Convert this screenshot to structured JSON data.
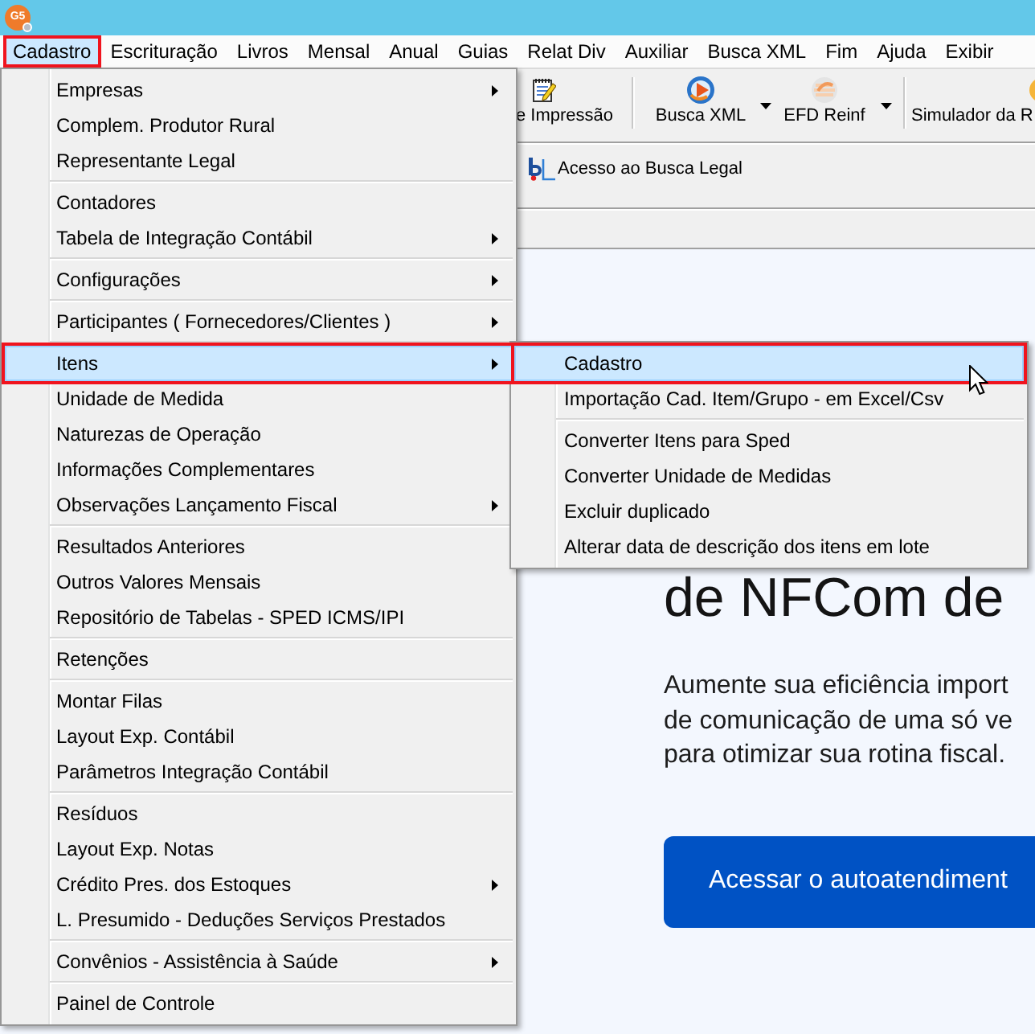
{
  "title_bar": {
    "logo_text": "G5"
  },
  "menu_bar": [
    {
      "label": "Cadastro",
      "selected": true,
      "outlined": true
    },
    {
      "label": "Escrituração",
      "selected": false,
      "outlined": false
    },
    {
      "label": "Livros",
      "selected": false,
      "outlined": false
    },
    {
      "label": "Mensal",
      "selected": false,
      "outlined": false
    },
    {
      "label": "Anual",
      "selected": false,
      "outlined": false
    },
    {
      "label": "Guias",
      "selected": false,
      "outlined": false
    },
    {
      "label": "Relat Div",
      "selected": false,
      "outlined": false
    },
    {
      "label": "Auxiliar",
      "selected": false,
      "outlined": false
    },
    {
      "label": "Busca XML",
      "selected": false,
      "outlined": false
    },
    {
      "label": "Fim",
      "selected": false,
      "outlined": false
    },
    {
      "label": "Ajuda",
      "selected": false,
      "outlined": false
    },
    {
      "label": "Exibir",
      "selected": false,
      "outlined": false
    }
  ],
  "toolbar": [
    {
      "kind": "button",
      "label": "e Impressão",
      "dropdown": false
    },
    {
      "kind": "separator"
    },
    {
      "kind": "button",
      "label": "Busca XML",
      "dropdown": true
    },
    {
      "kind": "button",
      "label": "EFD Reinf",
      "dropdown": true
    },
    {
      "kind": "separator"
    },
    {
      "kind": "button",
      "label": "Simulador da R",
      "dropdown": false
    }
  ],
  "link_bar": {
    "label": "Acesso ao Busca Legal"
  },
  "page": {
    "heading": "de NFCom de",
    "paragraph_lines": [
      "Aumente sua eficiência import",
      "de comunicação de uma só ve",
      "para otimizar sua rotina fiscal."
    ],
    "button": "Acessar o autoatendiment"
  },
  "dropdown_menu": {
    "items": [
      {
        "kind": "item",
        "label": "Empresas",
        "submenu": true,
        "selected": false,
        "outlined": false
      },
      {
        "kind": "item",
        "label": "Complem. Produtor Rural",
        "submenu": false,
        "selected": false,
        "outlined": false
      },
      {
        "kind": "item",
        "label": "Representante Legal",
        "submenu": false,
        "selected": false,
        "outlined": false
      },
      {
        "kind": "separator"
      },
      {
        "kind": "item",
        "label": "Contadores",
        "submenu": false,
        "selected": false,
        "outlined": false
      },
      {
        "kind": "item",
        "label": "Tabela de Integração Contábil",
        "submenu": true,
        "selected": false,
        "outlined": false
      },
      {
        "kind": "separator"
      },
      {
        "kind": "item",
        "label": "Configurações",
        "submenu": true,
        "selected": false,
        "outlined": false
      },
      {
        "kind": "separator"
      },
      {
        "kind": "item",
        "label": "Participantes ( Fornecedores/Clientes )",
        "submenu": true,
        "selected": false,
        "outlined": false
      },
      {
        "kind": "separator"
      },
      {
        "kind": "item",
        "label": "Itens",
        "submenu": true,
        "selected": true,
        "outlined": true
      },
      {
        "kind": "item",
        "label": "Unidade de Medida",
        "submenu": false,
        "selected": false,
        "outlined": false
      },
      {
        "kind": "item",
        "label": "Naturezas de Operação",
        "submenu": false,
        "selected": false,
        "outlined": false
      },
      {
        "kind": "item",
        "label": "Informações Complementares",
        "submenu": false,
        "selected": false,
        "outlined": false
      },
      {
        "kind": "item",
        "label": "Observações Lançamento Fiscal",
        "submenu": true,
        "selected": false,
        "outlined": false
      },
      {
        "kind": "separator"
      },
      {
        "kind": "item",
        "label": "Resultados Anteriores",
        "submenu": false,
        "selected": false,
        "outlined": false
      },
      {
        "kind": "item",
        "label": "Outros Valores Mensais",
        "submenu": false,
        "selected": false,
        "outlined": false
      },
      {
        "kind": "item",
        "label": "Repositório de Tabelas - SPED ICMS/IPI",
        "submenu": false,
        "selected": false,
        "outlined": false
      },
      {
        "kind": "separator"
      },
      {
        "kind": "item",
        "label": "Retenções",
        "submenu": false,
        "selected": false,
        "outlined": false
      },
      {
        "kind": "separator"
      },
      {
        "kind": "item",
        "label": "Montar Filas",
        "submenu": false,
        "selected": false,
        "outlined": false
      },
      {
        "kind": "item",
        "label": "Layout Exp. Contábil",
        "submenu": false,
        "selected": false,
        "outlined": false
      },
      {
        "kind": "item",
        "label": "Parâmetros Integração Contábil",
        "submenu": false,
        "selected": false,
        "outlined": false
      },
      {
        "kind": "separator"
      },
      {
        "kind": "item",
        "label": "Resíduos",
        "submenu": false,
        "selected": false,
        "outlined": false
      },
      {
        "kind": "item",
        "label": "Layout Exp. Notas",
        "submenu": false,
        "selected": false,
        "outlined": false
      },
      {
        "kind": "item",
        "label": "Crédito Pres. dos Estoques",
        "submenu": true,
        "selected": false,
        "outlined": false
      },
      {
        "kind": "item",
        "label": "L. Presumido - Deduções Serviços Prestados",
        "submenu": false,
        "selected": false,
        "outlined": false
      },
      {
        "kind": "separator"
      },
      {
        "kind": "item",
        "label": "Convênios - Assistência à Saúde",
        "submenu": true,
        "selected": false,
        "outlined": false
      },
      {
        "kind": "separator"
      },
      {
        "kind": "item",
        "label": "Painel de Controle",
        "submenu": false,
        "selected": false,
        "outlined": false
      }
    ]
  },
  "submenu": {
    "items": [
      {
        "kind": "item",
        "label": "Cadastro",
        "submenu": false,
        "selected": true,
        "outlined": true
      },
      {
        "kind": "item",
        "label": "Importação Cad. Item/Grupo - em Excel/Csv",
        "submenu": false,
        "selected": false,
        "outlined": false
      },
      {
        "kind": "separator"
      },
      {
        "kind": "item",
        "label": "Converter Itens para Sped",
        "submenu": false,
        "selected": false,
        "outlined": false
      },
      {
        "kind": "item",
        "label": "Converter Unidade de Medidas",
        "submenu": false,
        "selected": false,
        "outlined": false
      },
      {
        "kind": "item",
        "label": "Excluir duplicado",
        "submenu": false,
        "selected": false,
        "outlined": false
      },
      {
        "kind": "item",
        "label": "Alterar data de descrição dos itens em lote",
        "submenu": false,
        "selected": false,
        "outlined": false
      }
    ]
  }
}
